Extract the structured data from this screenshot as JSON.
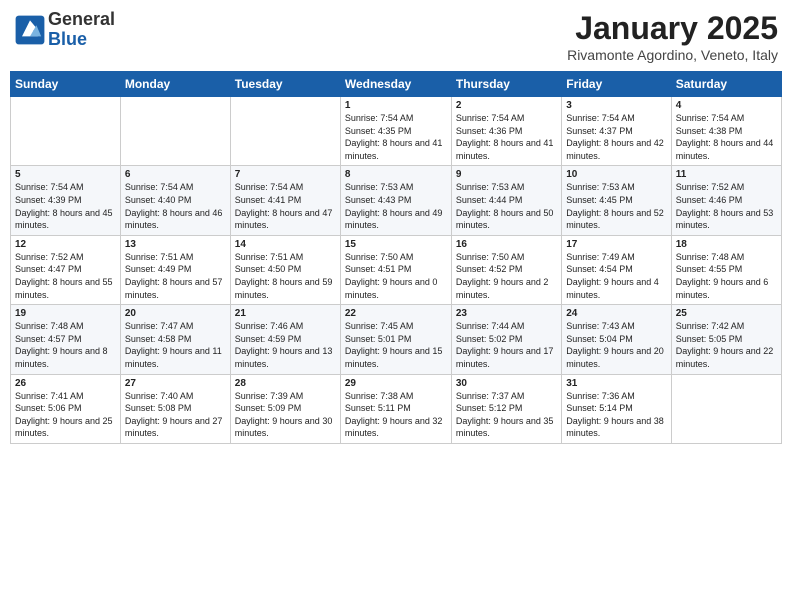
{
  "header": {
    "logo_general": "General",
    "logo_blue": "Blue",
    "title": "January 2025",
    "location": "Rivamonte Agordino, Veneto, Italy"
  },
  "days_of_week": [
    "Sunday",
    "Monday",
    "Tuesday",
    "Wednesday",
    "Thursday",
    "Friday",
    "Saturday"
  ],
  "weeks": [
    [
      {
        "day": "",
        "info": ""
      },
      {
        "day": "",
        "info": ""
      },
      {
        "day": "",
        "info": ""
      },
      {
        "day": "1",
        "info": "Sunrise: 7:54 AM\nSunset: 4:35 PM\nDaylight: 8 hours and 41 minutes."
      },
      {
        "day": "2",
        "info": "Sunrise: 7:54 AM\nSunset: 4:36 PM\nDaylight: 8 hours and 41 minutes."
      },
      {
        "day": "3",
        "info": "Sunrise: 7:54 AM\nSunset: 4:37 PM\nDaylight: 8 hours and 42 minutes."
      },
      {
        "day": "4",
        "info": "Sunrise: 7:54 AM\nSunset: 4:38 PM\nDaylight: 8 hours and 44 minutes."
      }
    ],
    [
      {
        "day": "5",
        "info": "Sunrise: 7:54 AM\nSunset: 4:39 PM\nDaylight: 8 hours and 45 minutes."
      },
      {
        "day": "6",
        "info": "Sunrise: 7:54 AM\nSunset: 4:40 PM\nDaylight: 8 hours and 46 minutes."
      },
      {
        "day": "7",
        "info": "Sunrise: 7:54 AM\nSunset: 4:41 PM\nDaylight: 8 hours and 47 minutes."
      },
      {
        "day": "8",
        "info": "Sunrise: 7:53 AM\nSunset: 4:43 PM\nDaylight: 8 hours and 49 minutes."
      },
      {
        "day": "9",
        "info": "Sunrise: 7:53 AM\nSunset: 4:44 PM\nDaylight: 8 hours and 50 minutes."
      },
      {
        "day": "10",
        "info": "Sunrise: 7:53 AM\nSunset: 4:45 PM\nDaylight: 8 hours and 52 minutes."
      },
      {
        "day": "11",
        "info": "Sunrise: 7:52 AM\nSunset: 4:46 PM\nDaylight: 8 hours and 53 minutes."
      }
    ],
    [
      {
        "day": "12",
        "info": "Sunrise: 7:52 AM\nSunset: 4:47 PM\nDaylight: 8 hours and 55 minutes."
      },
      {
        "day": "13",
        "info": "Sunrise: 7:51 AM\nSunset: 4:49 PM\nDaylight: 8 hours and 57 minutes."
      },
      {
        "day": "14",
        "info": "Sunrise: 7:51 AM\nSunset: 4:50 PM\nDaylight: 8 hours and 59 minutes."
      },
      {
        "day": "15",
        "info": "Sunrise: 7:50 AM\nSunset: 4:51 PM\nDaylight: 9 hours and 0 minutes."
      },
      {
        "day": "16",
        "info": "Sunrise: 7:50 AM\nSunset: 4:52 PM\nDaylight: 9 hours and 2 minutes."
      },
      {
        "day": "17",
        "info": "Sunrise: 7:49 AM\nSunset: 4:54 PM\nDaylight: 9 hours and 4 minutes."
      },
      {
        "day": "18",
        "info": "Sunrise: 7:48 AM\nSunset: 4:55 PM\nDaylight: 9 hours and 6 minutes."
      }
    ],
    [
      {
        "day": "19",
        "info": "Sunrise: 7:48 AM\nSunset: 4:57 PM\nDaylight: 9 hours and 8 minutes."
      },
      {
        "day": "20",
        "info": "Sunrise: 7:47 AM\nSunset: 4:58 PM\nDaylight: 9 hours and 11 minutes."
      },
      {
        "day": "21",
        "info": "Sunrise: 7:46 AM\nSunset: 4:59 PM\nDaylight: 9 hours and 13 minutes."
      },
      {
        "day": "22",
        "info": "Sunrise: 7:45 AM\nSunset: 5:01 PM\nDaylight: 9 hours and 15 minutes."
      },
      {
        "day": "23",
        "info": "Sunrise: 7:44 AM\nSunset: 5:02 PM\nDaylight: 9 hours and 17 minutes."
      },
      {
        "day": "24",
        "info": "Sunrise: 7:43 AM\nSunset: 5:04 PM\nDaylight: 9 hours and 20 minutes."
      },
      {
        "day": "25",
        "info": "Sunrise: 7:42 AM\nSunset: 5:05 PM\nDaylight: 9 hours and 22 minutes."
      }
    ],
    [
      {
        "day": "26",
        "info": "Sunrise: 7:41 AM\nSunset: 5:06 PM\nDaylight: 9 hours and 25 minutes."
      },
      {
        "day": "27",
        "info": "Sunrise: 7:40 AM\nSunset: 5:08 PM\nDaylight: 9 hours and 27 minutes."
      },
      {
        "day": "28",
        "info": "Sunrise: 7:39 AM\nSunset: 5:09 PM\nDaylight: 9 hours and 30 minutes."
      },
      {
        "day": "29",
        "info": "Sunrise: 7:38 AM\nSunset: 5:11 PM\nDaylight: 9 hours and 32 minutes."
      },
      {
        "day": "30",
        "info": "Sunrise: 7:37 AM\nSunset: 5:12 PM\nDaylight: 9 hours and 35 minutes."
      },
      {
        "day": "31",
        "info": "Sunrise: 7:36 AM\nSunset: 5:14 PM\nDaylight: 9 hours and 38 minutes."
      },
      {
        "day": "",
        "info": ""
      }
    ]
  ]
}
